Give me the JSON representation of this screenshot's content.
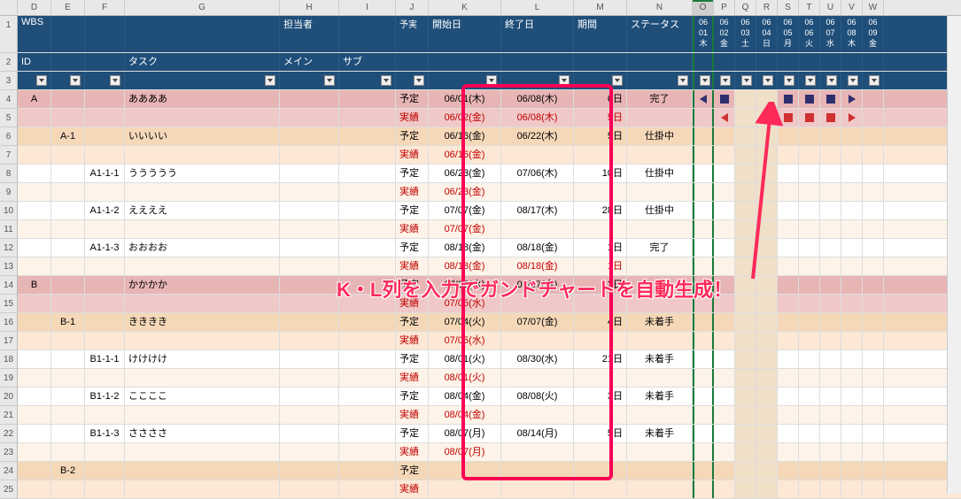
{
  "columns": [
    "D",
    "E",
    "F",
    "G",
    "H",
    "I",
    "J",
    "K",
    "L",
    "M",
    "N",
    "O",
    "P",
    "Q",
    "R",
    "S",
    "T",
    "U",
    "V",
    "W"
  ],
  "selected_column": "O",
  "row_numbers": [
    "1",
    "2",
    "3",
    "4",
    "5",
    "6",
    "7",
    "8",
    "9",
    "10",
    "11",
    "12",
    "13",
    "14",
    "15",
    "16",
    "17",
    "18",
    "19",
    "20",
    "21",
    "22",
    "23",
    "24",
    "25"
  ],
  "header1": {
    "wbs": "WBS",
    "tantou": "担当者",
    "yojitsu": "予実",
    "kaishi": "開始日",
    "shuuryou": "終了日",
    "kikan": "期間",
    "status": "ステータス"
  },
  "header2": {
    "id": "ID",
    "task": "タスク",
    "main": "メイン",
    "sub": "サブ"
  },
  "date_headers": [
    {
      "m": "06",
      "d": "01",
      "w": "木"
    },
    {
      "m": "06",
      "d": "02",
      "w": "金"
    },
    {
      "m": "06",
      "d": "03",
      "w": "土"
    },
    {
      "m": "06",
      "d": "04",
      "w": "日"
    },
    {
      "m": "06",
      "d": "05",
      "w": "月"
    },
    {
      "m": "06",
      "d": "06",
      "w": "火"
    },
    {
      "m": "06",
      "d": "07",
      "w": "水"
    },
    {
      "m": "06",
      "d": "08",
      "w": "木"
    },
    {
      "m": "06",
      "d": "09",
      "w": "金"
    }
  ],
  "yojitsu_labels": {
    "plan": "予定",
    "actual": "実績"
  },
  "callout_text": "K・L列を入力でガンドチャートを自動生成！",
  "rows": [
    {
      "r": 4,
      "lvl": 0,
      "id": "A",
      "task": "ああああ",
      "type": "plan",
      "start": "06/01(木)",
      "end": "06/08(木)",
      "dur": "6日",
      "status": "完了",
      "gantt": [
        "tl",
        "sq",
        "",
        "",
        "sq",
        "sq",
        "sq",
        "tr",
        ""
      ]
    },
    {
      "r": 5,
      "lvl": 0,
      "type": "actual",
      "start": "06/02(金)",
      "end": "06/08(木)",
      "dur": "5日",
      "gantt": [
        "",
        "tlr",
        "",
        "",
        "rd",
        "rd",
        "rd",
        "trr",
        ""
      ]
    },
    {
      "r": 6,
      "lvl": 1,
      "id": "A-1",
      "task": "いいいい",
      "type": "plan",
      "start": "06/16(金)",
      "end": "06/22(木)",
      "dur": "5日",
      "status": "仕掛中"
    },
    {
      "r": 7,
      "lvl": 1,
      "type": "actual",
      "start": "06/16(金)"
    },
    {
      "r": 8,
      "lvl": 2,
      "id": "A1-1-1",
      "task": "ううううう",
      "type": "plan",
      "start": "06/23(金)",
      "end": "07/06(木)",
      "dur": "10日",
      "status": "仕掛中"
    },
    {
      "r": 9,
      "lvl": 2,
      "type": "actual",
      "start": "06/23(金)"
    },
    {
      "r": 10,
      "lvl": 2,
      "id": "A1-1-2",
      "task": "ええええ",
      "type": "plan",
      "start": "07/07(金)",
      "end": "08/17(木)",
      "dur": "28日",
      "status": "仕掛中"
    },
    {
      "r": 11,
      "lvl": 2,
      "type": "actual",
      "start": "07/07(金)"
    },
    {
      "r": 12,
      "lvl": 2,
      "id": "A1-1-3",
      "task": "おおおお",
      "type": "plan",
      "start": "08/18(金)",
      "end": "08/18(金)",
      "dur": "1日",
      "status": "完了"
    },
    {
      "r": 13,
      "lvl": 2,
      "type": "actual",
      "start": "08/18(金)",
      "end": "08/18(金)",
      "dur": "1日"
    },
    {
      "r": 14,
      "lvl": 0,
      "id": "B",
      "task": "かかかか",
      "type": "plan",
      "start": "07/05(水)",
      "end": "07/07(金)",
      "dur": "3日"
    },
    {
      "r": 15,
      "lvl": 0,
      "type": "actual",
      "start": "07/05(水)"
    },
    {
      "r": 16,
      "lvl": 1,
      "id": "B-1",
      "task": "きききき",
      "type": "plan",
      "start": "07/04(火)",
      "end": "07/07(金)",
      "dur": "4日",
      "status": "未着手"
    },
    {
      "r": 17,
      "lvl": 1,
      "type": "actual",
      "start": "07/05(水)"
    },
    {
      "r": 18,
      "lvl": 2,
      "id": "B1-1-1",
      "task": "けけけけ",
      "type": "plan",
      "start": "08/01(火)",
      "end": "08/30(水)",
      "dur": "21日",
      "status": "未着手"
    },
    {
      "r": 19,
      "lvl": 2,
      "type": "actual",
      "start": "08/01(火)"
    },
    {
      "r": 20,
      "lvl": 2,
      "id": "B1-1-2",
      "task": "ここここ",
      "type": "plan",
      "start": "08/04(金)",
      "end": "08/08(火)",
      "dur": "3日",
      "status": "未着手"
    },
    {
      "r": 21,
      "lvl": 2,
      "type": "actual",
      "start": "08/04(金)"
    },
    {
      "r": 22,
      "lvl": 2,
      "id": "B1-1-3",
      "task": "ささささ",
      "type": "plan",
      "start": "08/07(月)",
      "end": "08/14(月)",
      "dur": "5日",
      "status": "未着手"
    },
    {
      "r": 23,
      "lvl": 2,
      "type": "actual",
      "start": "08/07(月)"
    },
    {
      "r": 24,
      "lvl": 1,
      "id": "B-2",
      "task": "",
      "type": "plan"
    },
    {
      "r": 25,
      "lvl": 1,
      "type": "actual"
    }
  ]
}
